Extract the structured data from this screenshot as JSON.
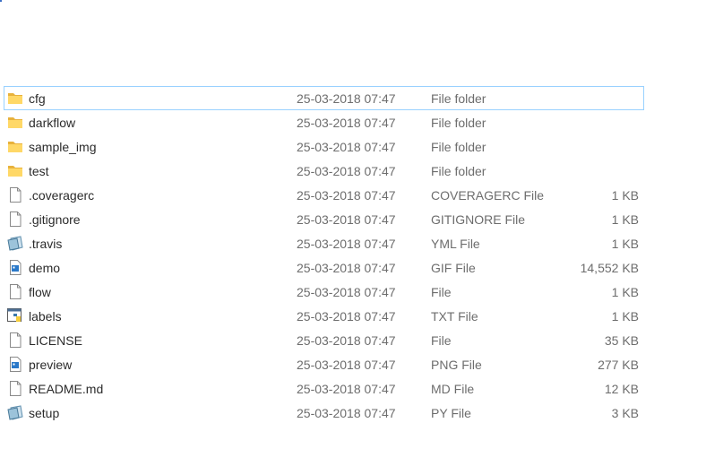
{
  "files": [
    {
      "name": "cfg",
      "date": "25-03-2018 07:47",
      "type": "File folder",
      "size": "",
      "icon": "folder-icon"
    },
    {
      "name": "darkflow",
      "date": "25-03-2018 07:47",
      "type": "File folder",
      "size": "",
      "icon": "folder-icon"
    },
    {
      "name": "sample_img",
      "date": "25-03-2018 07:47",
      "type": "File folder",
      "size": "",
      "icon": "folder-icon"
    },
    {
      "name": "test",
      "date": "25-03-2018 07:47",
      "type": "File folder",
      "size": "",
      "icon": "folder-icon"
    },
    {
      "name": ".coveragerc",
      "date": "25-03-2018 07:47",
      "type": "COVERAGERC File",
      "size": "1 KB",
      "icon": "blank-file-icon"
    },
    {
      "name": ".gitignore",
      "date": "25-03-2018 07:47",
      "type": "GITIGNORE File",
      "size": "1 KB",
      "icon": "blank-file-icon"
    },
    {
      "name": ".travis",
      "date": "25-03-2018 07:47",
      "type": "YML File",
      "size": "1 KB",
      "icon": "notepad-file-icon"
    },
    {
      "name": "demo",
      "date": "25-03-2018 07:47",
      "type": "GIF File",
      "size": "14,552 KB",
      "icon": "image-file-icon"
    },
    {
      "name": "flow",
      "date": "25-03-2018 07:47",
      "type": "File",
      "size": "1 KB",
      "icon": "blank-file-icon"
    },
    {
      "name": "labels",
      "date": "25-03-2018 07:47",
      "type": "TXT File",
      "size": "1 KB",
      "icon": "python-file-icon"
    },
    {
      "name": "LICENSE",
      "date": "25-03-2018 07:47",
      "type": "File",
      "size": "35 KB",
      "icon": "blank-file-icon"
    },
    {
      "name": "preview",
      "date": "25-03-2018 07:47",
      "type": "PNG File",
      "size": "277 KB",
      "icon": "image-file-icon"
    },
    {
      "name": "README.md",
      "date": "25-03-2018 07:47",
      "type": "MD File",
      "size": "12 KB",
      "icon": "blank-file-icon"
    },
    {
      "name": "setup",
      "date": "25-03-2018 07:47",
      "type": "PY File",
      "size": "3 KB",
      "icon": "notepad-file-icon"
    }
  ],
  "selected_index": 0,
  "colors": {
    "selection_border": "#99d1ff",
    "folder": "#f0c44c",
    "secondary_text": "#6d6d6d"
  }
}
